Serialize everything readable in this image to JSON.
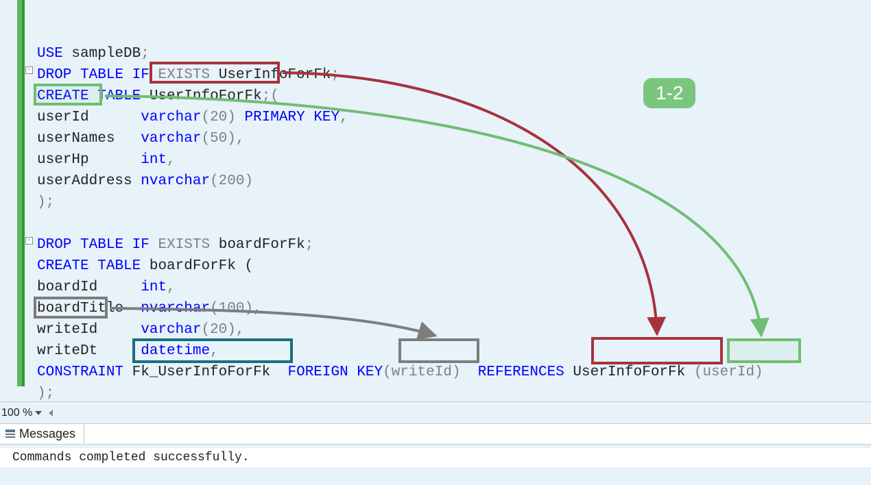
{
  "badge": "1-2",
  "zoom": "100 %",
  "messages_tab": "Messages",
  "messages_output": "Commands completed successfully.",
  "sql": {
    "l1": [
      "USE",
      " sampleDB",
      ";"
    ],
    "l2": [
      "DROP",
      " ",
      "TABLE",
      " ",
      "IF",
      " ",
      "EXISTS",
      " UserInfoForFk",
      ";"
    ],
    "l3": [
      "CREATE",
      " ",
      "TABLE",
      " UserInfoForFk",
      ";",
      "("
    ],
    "c1_name": "userId",
    "c1_type": "varchar",
    "c1_args": "(20)",
    "c1_extra": "PRIMARY KEY",
    "c2_name": "userNames",
    "c2_type": "varchar",
    "c2_args": "(50)",
    "c3_name": "userHp",
    "c3_type": "int",
    "c4_name": "userAddress",
    "c4_type": "nvarchar",
    "c4_args": "(200)",
    "end1": ");",
    "l5": [
      "DROP",
      " ",
      "TABLE",
      " ",
      "IF",
      " ",
      "EXISTS",
      " boardForFk",
      ";"
    ],
    "l6": [
      "CREATE",
      " ",
      "TABLE",
      " boardForFk ("
    ],
    "b1_name": "boardId",
    "b1_type": "int",
    "b2_name": "boardTitle",
    "b2_type": "nvarchar",
    "b2_args": "(100)",
    "b3_name": "writeId",
    "b3_type": "varchar",
    "b3_args": "(20)",
    "b4_name": "writeDt",
    "b4_type": "datetime",
    "con_kw": "CONSTRAINT",
    "con_name": "Fk_UserInfoForFk",
    "fk_kw": "FOREIGN KEY",
    "fk_col": "(writeId)",
    "ref_kw": "REFERENCES",
    "ref_tbl": "UserInfoForFk",
    "ref_col": "(userId)",
    "end2": ");"
  }
}
